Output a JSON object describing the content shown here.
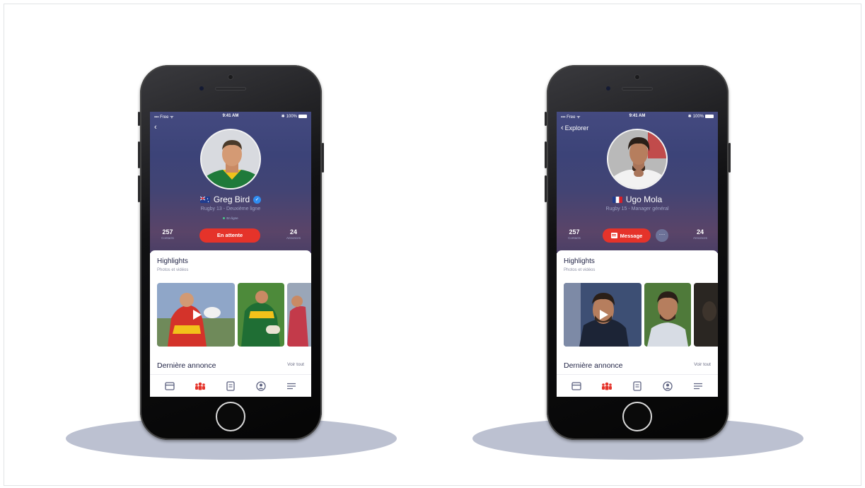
{
  "colors": {
    "accent": "#e5332a",
    "header_gradient_top": "#444a80",
    "header_gradient_bottom": "#4a3f66",
    "verified": "#2f8df0",
    "title_text": "#1f2244"
  },
  "phones": [
    {
      "status": {
        "carrier": "Free",
        "time": "9:41 AM",
        "battery": "100%"
      },
      "back_label": "",
      "profile": {
        "name": "Greg Bird",
        "flag": "australia-flag",
        "verified": true,
        "subtitle": "Rugby 13 - Deuxième ligne",
        "online": "En ligne"
      },
      "stats": {
        "contacts": "257",
        "contacts_label": "Contacts",
        "annonces": "24",
        "annonces_label": "Annonces"
      },
      "action_button": "En attente",
      "highlights": {
        "title": "Highlights",
        "subtitle": "Photos et vidéos"
      },
      "annonce": {
        "title": "Dernière annonce",
        "link": "Voir tout"
      },
      "tabs": [
        "calendar-icon",
        "team-icon",
        "document-icon",
        "profile-icon",
        "menu-icon"
      ],
      "active_tab": "team-icon"
    },
    {
      "status": {
        "carrier": "Free",
        "time": "9:41 AM",
        "battery": "100%"
      },
      "back_label": "Explorer",
      "profile": {
        "name": "Ugo Mola",
        "flag": "france-flag",
        "verified": false,
        "subtitle": "Rugby 15 - Manager général"
      },
      "stats": {
        "contacts": "257",
        "contacts_label": "Contacts",
        "annonces": "24",
        "annonces_label": "Annonces"
      },
      "action_button": "Message",
      "more_button": "···",
      "highlights": {
        "title": "Highlights",
        "subtitle": "Photos et vidéos"
      },
      "annonce": {
        "title": "Dernière annonce",
        "link": "Voir tout"
      },
      "tabs": [
        "calendar-icon",
        "team-icon",
        "document-icon",
        "profile-icon",
        "menu-icon"
      ],
      "active_tab": "team-icon"
    }
  ]
}
